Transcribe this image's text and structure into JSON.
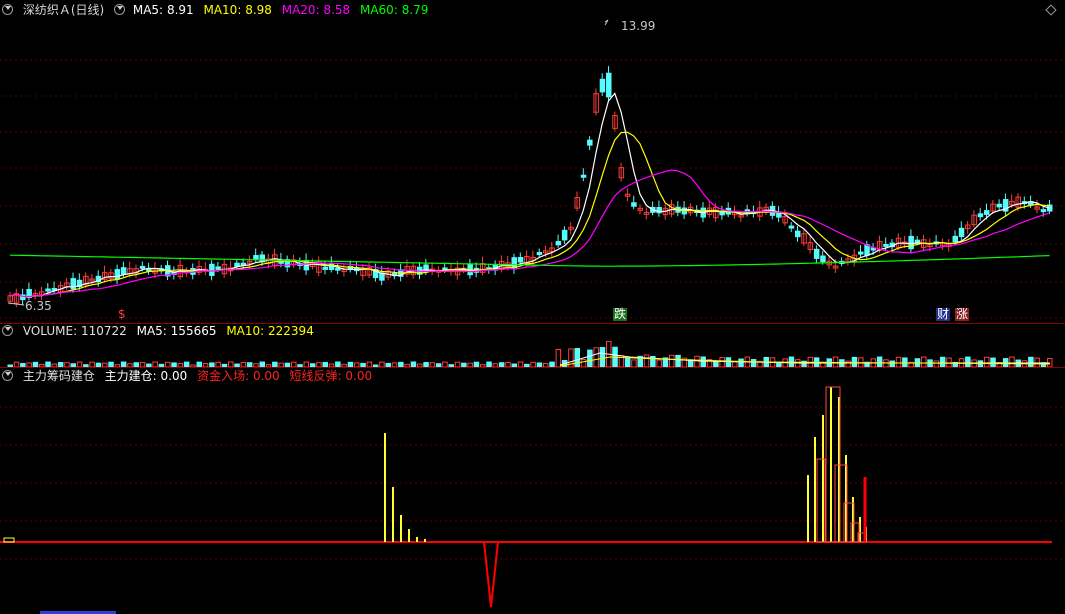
{
  "price": {
    "title": "深纺织Ａ(日线)",
    "ma5_label": "MA5:",
    "ma5": "8.91",
    "ma10_label": "MA10:",
    "ma10": "8.98",
    "ma20_label": "MA20:",
    "ma20": "8.58",
    "ma60_label": "MA60:",
    "ma60": "8.79",
    "high_mark": "13.99",
    "low_mark": "6.35",
    "markers": [
      "$",
      "跌",
      "财",
      "涨"
    ],
    "colors": {
      "ma5": "#ffffff",
      "ma10": "#ffff00",
      "ma20": "#ff00ff",
      "ma60": "#00ff00",
      "up": "#ff3c3c",
      "down": "#54fcfc"
    }
  },
  "volume": {
    "title": "VOLUME:",
    "value": "110722",
    "ma5_label": "MA5:",
    "ma5": "155665",
    "ma10_label": "MA10:",
    "ma10": "222394"
  },
  "indicator": {
    "title": "主力筹码建仓",
    "l1_label": "主力建仓:",
    "l1": "0.00",
    "l2_label": "资金入场:",
    "l2": "0.00",
    "l3_label": "短线反弹:",
    "l3": "0.00"
  }
}
